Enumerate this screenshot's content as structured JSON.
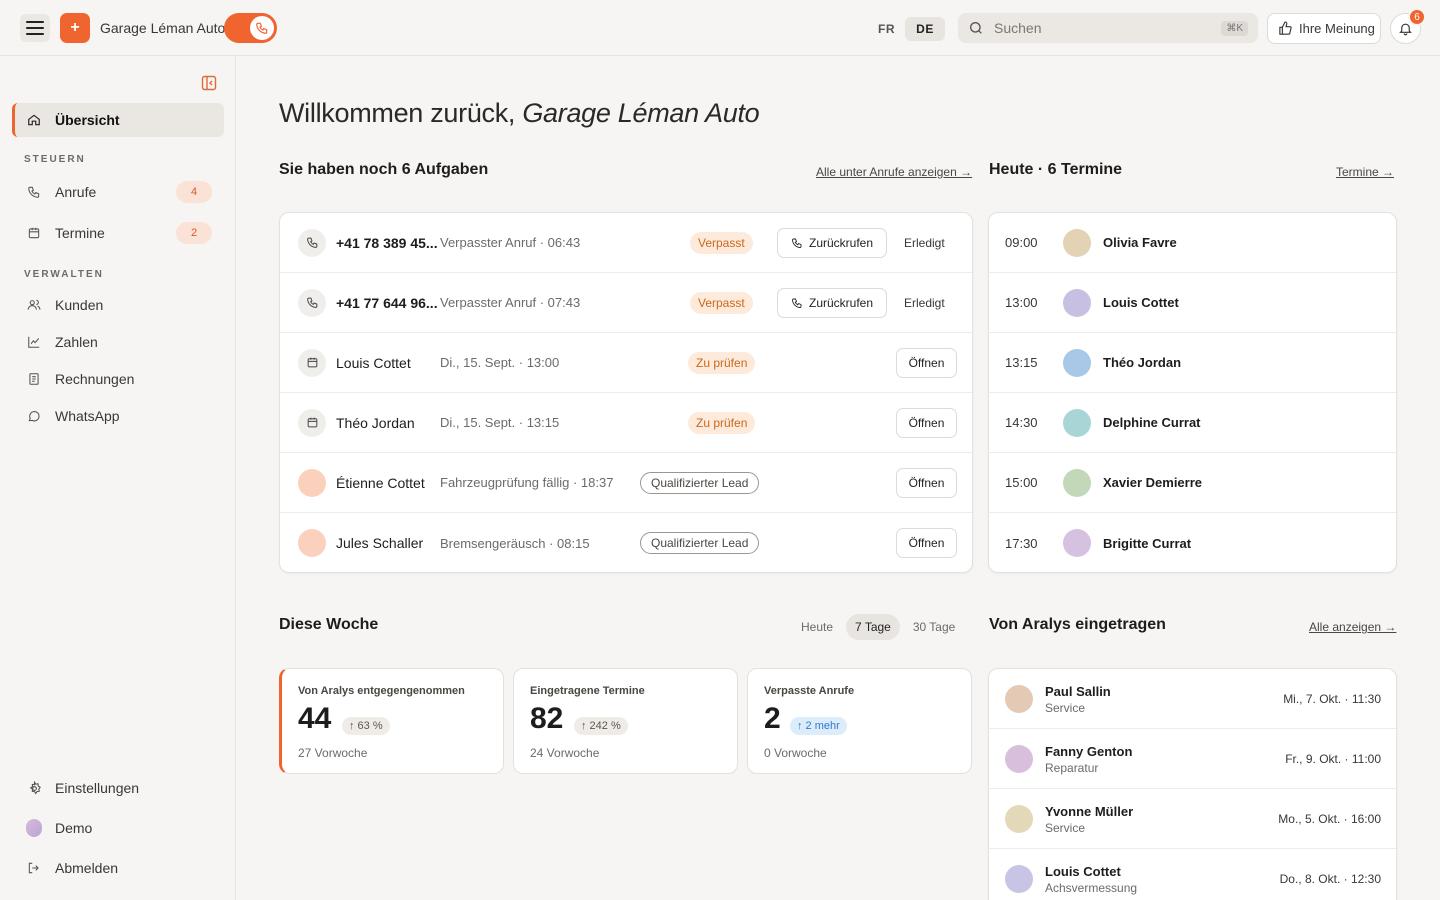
{
  "topbar": {
    "brand_initial": "+",
    "brand_name": "Garage Léman Auto",
    "lang_fr": "FR",
    "lang_de": "DE",
    "search_placeholder": "Suchen",
    "search_shortcut": "⌘K",
    "feedback_label": "Ihre Meinung",
    "notification_count": "6"
  },
  "sidebar": {
    "overview": "Übersicht",
    "section_steuern": "STEUERN",
    "calls": "Anrufe",
    "calls_count": "4",
    "appointments": "Termine",
    "appointments_count": "2",
    "section_verwalten": "VERWALTEN",
    "customers": "Kunden",
    "numbers": "Zahlen",
    "invoices": "Rechnungen",
    "whatsapp": "WhatsApp",
    "settings": "Einstellungen",
    "demo": "Demo",
    "logout": "Abmelden"
  },
  "main": {
    "welcome_prefix": "Willkommen zurück, ",
    "welcome_name": "Garage Léman Auto",
    "tasks_title": "Sie haben noch 6 Aufgaben",
    "tasks_link": "Alle unter Anrufe anzeigen →",
    "today_title": "Heute · 6 Termine",
    "today_link": "Termine →",
    "week_title": "Diese Woche",
    "booked_title": "Von Aralys eingetragen",
    "booked_link": "Alle anzeigen →"
  },
  "tasks": [
    {
      "name": "+41 78 389 45...",
      "desc": "Verpasster Anruf · 06:43",
      "status": "Verpasst",
      "action": "Zurückrufen",
      "secondary": "Erledigt"
    },
    {
      "name": "+41 77 644 96...",
      "desc": "Verpasster Anruf · 07:43",
      "status": "Verpasst",
      "action": "Zurückrufen",
      "secondary": "Erledigt"
    },
    {
      "name": "Louis Cottet",
      "desc": "Di., 15. Sept. · 13:00",
      "status": "Zu prüfen",
      "action": "Öffnen"
    },
    {
      "name": "Théo Jordan",
      "desc": "Di., 15. Sept. · 13:15",
      "status": "Zu prüfen",
      "action": "Öffnen"
    },
    {
      "name": "Étienne Cottet",
      "desc": "Fahrzeugprüfung fällig · 18:37",
      "status": "Qualifizierter Lead",
      "action": "Öffnen"
    },
    {
      "name": "Jules Schaller",
      "desc": "Bremsengeräusch · 08:15",
      "status": "Qualifizierter Lead",
      "action": "Öffnen"
    }
  ],
  "appointments": [
    {
      "time": "09:00",
      "name": "Olivia Favre",
      "color": "#e3d2b4"
    },
    {
      "time": "13:00",
      "name": "Louis Cottet",
      "color": "#c7c0e3"
    },
    {
      "time": "13:15",
      "name": "Théo Jordan",
      "color": "#a9c7e8"
    },
    {
      "time": "14:30",
      "name": "Delphine Currat",
      "color": "#a8d6d6"
    },
    {
      "time": "15:00",
      "name": "Xavier Demierre",
      "color": "#c2d8b9"
    },
    {
      "time": "17:30",
      "name": "Brigitte Currat",
      "color": "#d7c1e0"
    }
  ],
  "range_tabs": {
    "today": "Heute",
    "seven": "7 Tage",
    "thirty": "30 Tage"
  },
  "stats": [
    {
      "label": "Von Aralys entgegengenommen",
      "value": "44",
      "chip": "↑ 63 %",
      "sub": "27 Vorwoche"
    },
    {
      "label": "Eingetragene Termine",
      "value": "82",
      "chip": "↑ 242 %",
      "sub": "24 Vorwoche"
    },
    {
      "label": "Verpasste Anrufe",
      "value": "2",
      "chip": "↑ 2 mehr",
      "sub": "0 Vorwoche"
    }
  ],
  "booked": [
    {
      "name": "Paul Sallin",
      "type": "Service",
      "date": "Mi., 7. Okt. · 11:30",
      "color": "#e4c9b5"
    },
    {
      "name": "Fanny Genton",
      "type": "Reparatur",
      "date": "Fr., 9. Okt. · 11:00",
      "color": "#d8c0dc"
    },
    {
      "name": "Yvonne Müller",
      "type": "Service",
      "date": "Mo., 5. Okt. · 16:00",
      "color": "#e3d8b8"
    },
    {
      "name": "Louis Cottet",
      "type": "Achsvermessung",
      "date": "Do., 8. Okt. · 12:30",
      "color": "#c7c4e6"
    }
  ],
  "colors": {
    "accent": "#f0642f",
    "background": "#f6f5f3"
  }
}
